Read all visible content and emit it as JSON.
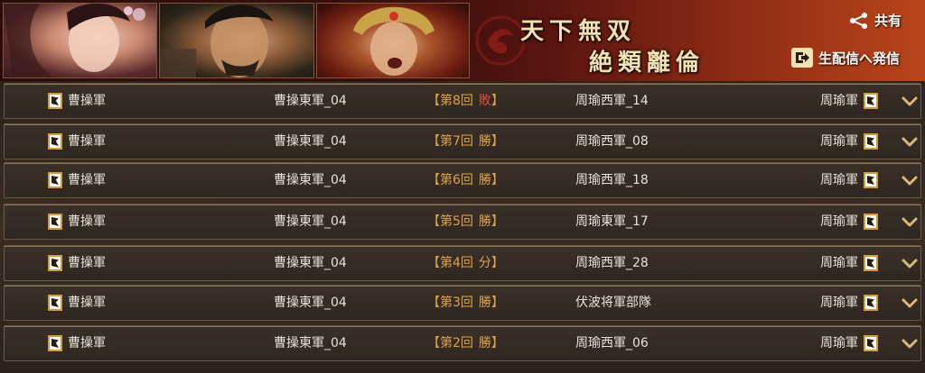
{
  "banner": {
    "title_line1": "天下無双",
    "title_line2": "絶類離倫",
    "share_label": "共有",
    "live_label": "生配信へ発信"
  },
  "colors": {
    "accent": "#e0a24a",
    "win": "#e0a24a",
    "loss": "#e04a3a",
    "text": "#e9e2d6"
  },
  "matches": [
    {
      "left_team": "曹操軍",
      "left_sub": "曹操東軍_04",
      "round": "【第8回",
      "result": "敗",
      "close": "】",
      "right_sub": "周瑜西軍_14",
      "right_team": "周瑜軍"
    },
    {
      "left_team": "曹操軍",
      "left_sub": "曹操東軍_04",
      "round": "【第7回",
      "result": "勝",
      "close": "】",
      "right_sub": "周瑜西軍_08",
      "right_team": "周瑜軍"
    },
    {
      "left_team": "曹操軍",
      "left_sub": "曹操東軍_04",
      "round": "【第6回",
      "result": "勝",
      "close": "】",
      "right_sub": "周瑜西軍_18",
      "right_team": "周瑜軍"
    },
    {
      "left_team": "曹操軍",
      "left_sub": "曹操東軍_04",
      "round": "【第5回",
      "result": "勝",
      "close": "】",
      "right_sub": "周瑜東軍_17",
      "right_team": "周瑜軍"
    },
    {
      "left_team": "曹操軍",
      "left_sub": "曹操東軍_04",
      "round": "【第4回",
      "result": "分",
      "close": "】",
      "right_sub": "周瑜西軍_28",
      "right_team": "周瑜軍"
    },
    {
      "left_team": "曹操軍",
      "left_sub": "曹操東軍_04",
      "round": "【第3回",
      "result": "勝",
      "close": "】",
      "right_sub": "伏波将軍部隊",
      "right_team": "周瑜軍"
    },
    {
      "left_team": "曹操軍",
      "left_sub": "曹操東軍_04",
      "round": "【第2回",
      "result": "勝",
      "close": "】",
      "right_sub": "周瑜西軍_06",
      "right_team": "周瑜軍"
    }
  ]
}
